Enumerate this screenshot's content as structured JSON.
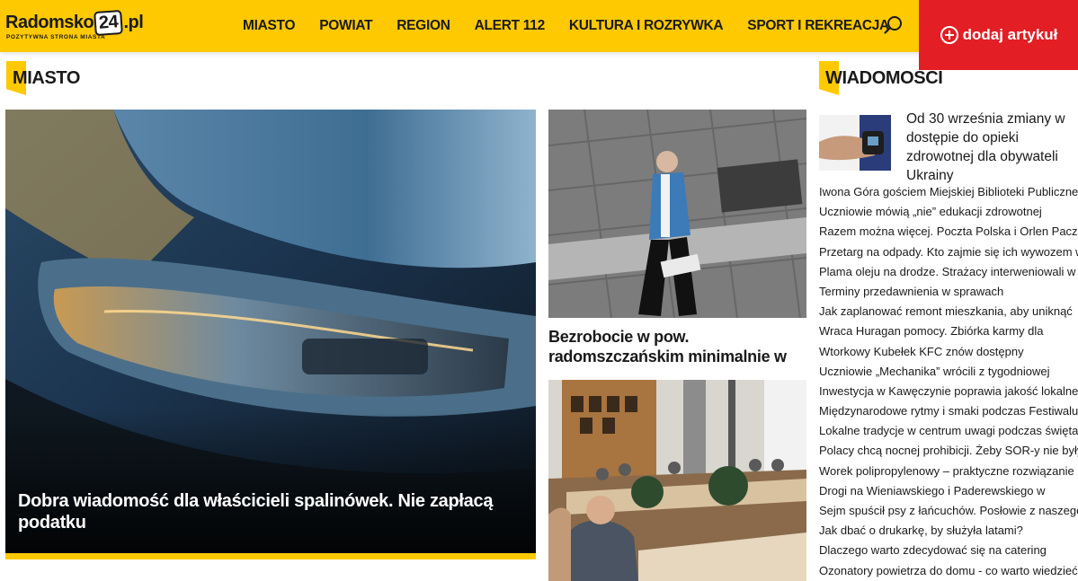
{
  "header": {
    "logo_text_a": "Radomsko",
    "logo_text_b": "24",
    "logo_text_c": ".pl",
    "logo_tagline": "POZYTYWNA STRONA MIASTA",
    "nav": [
      "MIASTO",
      "POWIAT",
      "REGION",
      "ALERT 112",
      "KULTURA I ROZRYWKA",
      "SPORT I REKREACJA"
    ],
    "add_article_label": "dodaj artykuł",
    "colors": {
      "bar": "#ffc900",
      "add_button": "#e31e24"
    }
  },
  "sections": {
    "left_title": "MIASTO",
    "right_title": "WIADOMOSCI"
  },
  "main_story": {
    "title": "Dobra wiadomość dla właścicieli spalinówek. Nie zapłacą podatku"
  },
  "side_stories": [
    {
      "title": "Bezrobocie w pow. radomszczańskim minimalnie w"
    },
    {
      "title": ""
    }
  ],
  "news": {
    "feature_title": "Od 30 września zmiany w dostępie do opieki zdrowotnej dla obywateli Ukrainy",
    "items": [
      "Iwona Góra gościem Miejskiej Biblioteki Publicznej",
      "Uczniowie mówią „nie” edukacji zdrowotnej",
      "Razem można więcej. Poczta Polska i Orlen Paczka",
      "Przetarg na odpady. Kto zajmie się ich wywozem w",
      "Plama oleju na drodze. Strażacy interweniowali w",
      "Terminy przedawnienia w sprawach",
      "Jak zaplanować remont mieszkania, aby uniknąć",
      "Wraca Huragan pomocy. Zbiórka karmy dla",
      "Wtorkowy Kubełek KFC znów dostępny",
      "Uczniowie „Mechanika” wrócili z tygodniowej",
      "Inwestycja w Kawęczynie poprawia jakość lokalnej",
      "Międzynarodowe rytmy i smaki podczas Festiwalu",
      "Lokalne tradycje w centrum uwagi podczas święta",
      "Polacy chcą nocnej prohibicji. Żeby SOR-y nie były",
      "Worek polipropylenowy – praktyczne rozwiązanie",
      "Drogi na Wieniawskiego i Paderewskiego w",
      "Sejm spuścił psy z łańcuchów. Posłowie z naszego",
      "Jak dbać o drukarkę, by służyła latami?",
      "Dlaczego warto zdecydować się na catering",
      "Ozonatory powietrza do domu - co warto wiedzieć,"
    ]
  }
}
